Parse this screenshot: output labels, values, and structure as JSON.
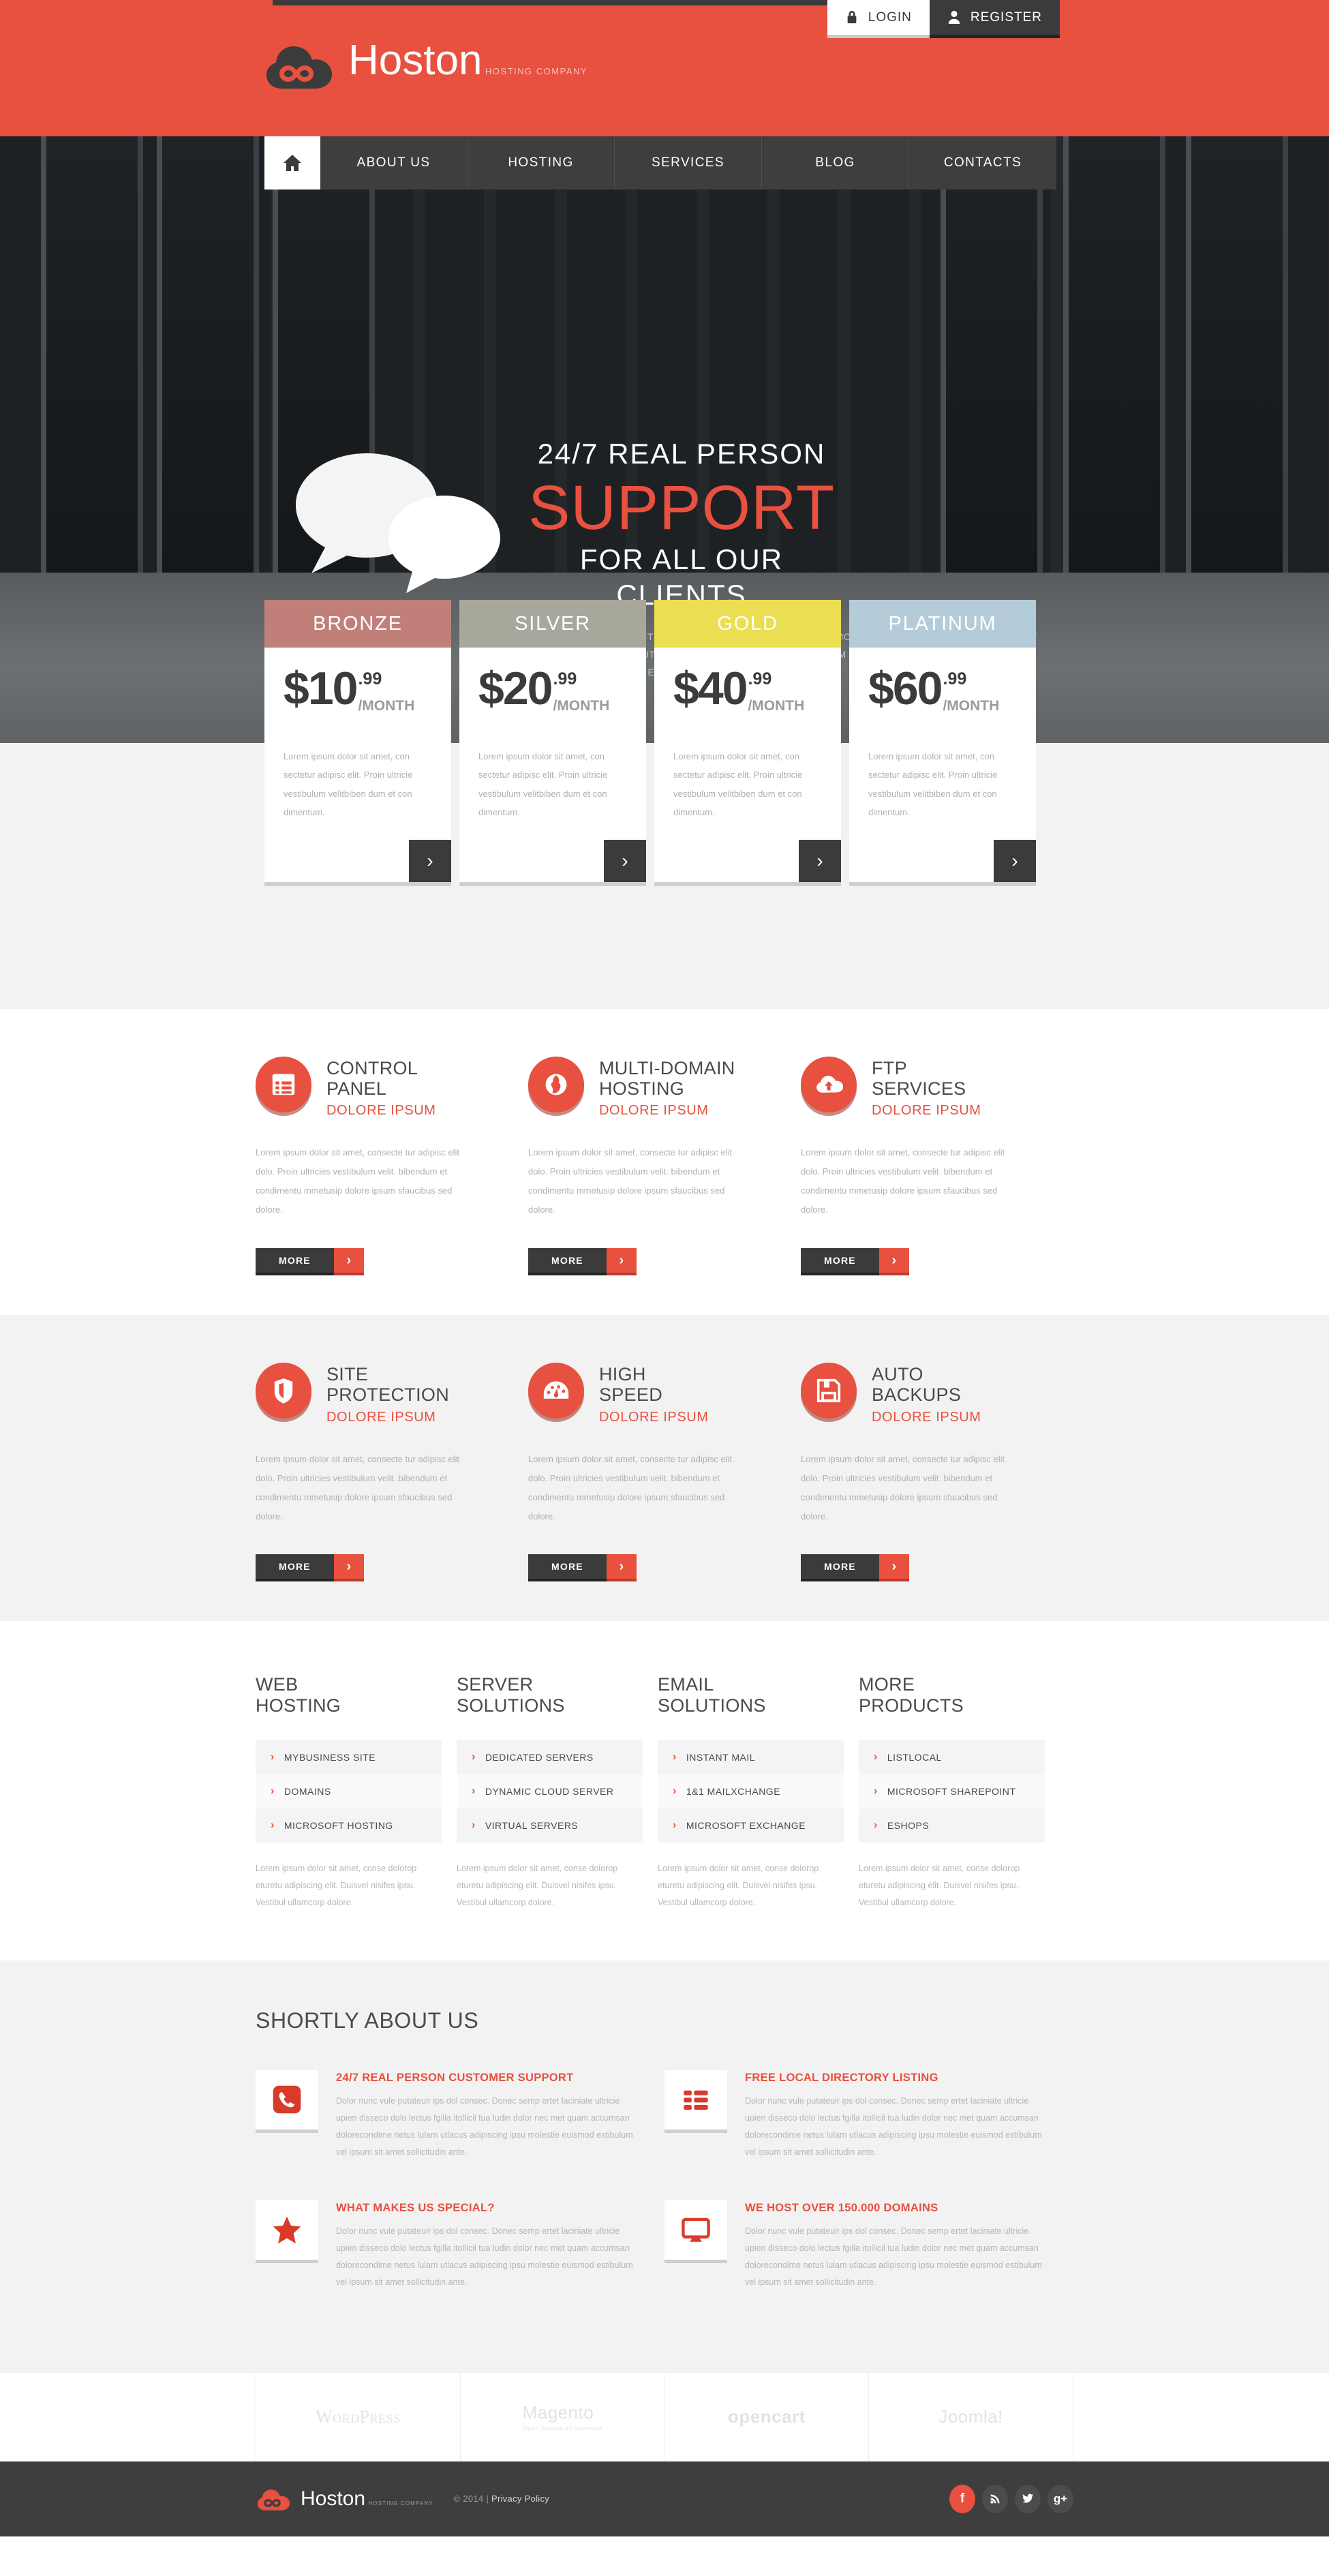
{
  "brand": {
    "name": "Hoston",
    "tagline": "HOSTING COMPANY",
    "logo_icon": "cloud-infinity-logo"
  },
  "auth": {
    "login_label": "LOGIN",
    "login_icon": "lock-icon",
    "register_label": "REGISTER",
    "register_icon": "user-icon"
  },
  "nav": {
    "home_icon": "home-icon",
    "items": [
      {
        "label": "ABOUT US"
      },
      {
        "label": "HOSTING"
      },
      {
        "label": "SERVICES"
      },
      {
        "label": "BLOG"
      },
      {
        "label": "CONTACTS"
      }
    ]
  },
  "hero": {
    "icon": "speech-bubbles-icon",
    "line1": "24/7 REAL PERSON",
    "line2": "SUPPORT",
    "line3": "FOR ALL OUR CLIENTS",
    "description": "DOLOR SIT AMET, CONSECTETUR ADIPISICING ELIT, SED DO EIUSMOD TEMPOR INCIDIDUNT UT LABORE ET DOLORE MAGNA ALIQUA. UT ENIM AD MINIM VENIAM. LOREM IPSUM DOLOR SIT AMET, CONSECTE TUR ADIPISICING ELIT, SED DO EIUSMOD TEMPOR."
  },
  "pricing": {
    "plans": [
      {
        "name": "BRONZE",
        "currency": "$",
        "amount": "10",
        "cents": ".99",
        "period": "/MONTH",
        "description": "Lorem ipsum dolor sit amet, con sectetur adipisc elit. Proin ultricie vestibulum velitbiben dum et con dimentum.",
        "color": "#c08079",
        "go_icon": "chevron-right-icon"
      },
      {
        "name": "SILVER",
        "currency": "$",
        "amount": "20",
        "cents": ".99",
        "period": "/MONTH",
        "description": "Lorem ipsum dolor sit amet, con sectetur adipisc elit. Proin ultricie vestibulum velitbiben dum et con dimentum.",
        "color": "#a8a79b",
        "go_icon": "chevron-right-icon"
      },
      {
        "name": "GOLD",
        "currency": "$",
        "amount": "40",
        "cents": ".99",
        "period": "/MONTH",
        "description": "Lorem ipsum dolor sit amet, con sectetur adipisc elit. Proin ultricie vestibulum velitbiben dum et con dimentum.",
        "color": "#ecde52",
        "go_icon": "chevron-right-icon"
      },
      {
        "name": "PLATINUM",
        "currency": "$",
        "amount": "60",
        "cents": ".99",
        "period": "/MONTH",
        "description": "Lorem ipsum dolor sit amet, con sectetur adipisc elit. Proin ultricie vestibulum velitbiben dum et con dimentum.",
        "color": "#b4ccd9",
        "go_icon": "chevron-right-icon"
      }
    ]
  },
  "services_row1": [
    {
      "title_line1": "CONTROL",
      "title_line2": "PANEL",
      "subtitle": "DOLORE IPSUM",
      "text": "Lorem ipsum dolor sit amet, consecte tur adipisc elit dolo. Proin ultricies vestibulum velit. bibendum et condimentu mmetusip dolore ipsum sfaucibus sed dolore.",
      "icon": "control-panel-list-icon",
      "button_label": "MORE"
    },
    {
      "title_line1": "MULTI-DOMAIN",
      "title_line2": "HOSTING",
      "subtitle": "DOLORE IPSUM",
      "text": "Lorem ipsum dolor sit amet, consecte tur adipisc elit dolo. Proin ultricies vestibulum velit. bibendum et condimentu mmetusip dolore ipsum sfaucibus sed dolore.",
      "icon": "globe-icon",
      "button_label": "MORE"
    },
    {
      "title_line1": "FTP",
      "title_line2": "SERVICES",
      "subtitle": "DOLORE IPSUM",
      "text": "Lorem ipsum dolor sit amet, consecte tur adipisc elit dolo. Proin ultricies vestibulum velit. bibendum et condimentu mmetusip dolore ipsum sfaucibus sed dolore.",
      "icon": "cloud-upload-icon",
      "button_label": "MORE"
    }
  ],
  "services_row2": [
    {
      "title_line1": "SITE",
      "title_line2": "PROTECTION",
      "subtitle": "DOLORE IPSUM",
      "text": "Lorem ipsum dolor sit amet, consecte tur adipisc elit dolo. Proin ultricies vestibulum velit. bibendum et condimentu mmetusip dolore ipsum sfaucibus sed dolore.",
      "icon": "shield-icon",
      "button_label": "MORE"
    },
    {
      "title_line1": "HIGH",
      "title_line2": "SPEED",
      "subtitle": "DOLORE IPSUM",
      "text": "Lorem ipsum dolor sit amet, consecte tur adipisc elit dolo. Proin ultricies vestibulum velit. bibendum et condimentu mmetusip dolore ipsum sfaucibus sed dolore.",
      "icon": "speedometer-icon",
      "button_label": "MORE"
    },
    {
      "title_line1": "AUTO",
      "title_line2": "BACKUPS",
      "subtitle": "DOLORE IPSUM",
      "text": "Lorem ipsum dolor sit amet, consecte tur adipisc elit dolo. Proin ultricies vestibulum velit. bibendum et condimentu mmetusip dolore ipsum sfaucibus sed dolore.",
      "icon": "floppy-disk-icon",
      "button_label": "MORE"
    }
  ],
  "link_columns": [
    {
      "title_line1": "WEB",
      "title_line2": "HOSTING",
      "items": [
        "MYBUSINESS SITE",
        "DOMAINS",
        "MICROSOFT HOSTING"
      ],
      "text": "Lorem ipsum dolor sit amet, conse dolorop eturetu adipiscing elit. Duisvel nisifes ipsu. Vestibul ullamcorp dolore."
    },
    {
      "title_line1": "SERVER",
      "title_line2": "SOLUTIONS",
      "items": [
        "DEDICATED SERVERS",
        "DYNAMIC CLOUD SERVER",
        "VIRTUAL SERVERS"
      ],
      "text": "Lorem ipsum dolor sit amet, conse dolorop eturetu adipiscing elit. Duisvel nisifes ipsu. Vestibul ullamcorp dolore."
    },
    {
      "title_line1": "EMAIL",
      "title_line2": "SOLUTIONS",
      "items": [
        "INSTANT MAIL",
        "1&1 MAILXCHANGE",
        "MICROSOFT EXCHANGE"
      ],
      "text": "Lorem ipsum dolor sit amet, conse dolorop eturetu adipiscing elit. Duisvel nisifes ipsu. Vestibul ullamcorp dolore."
    },
    {
      "title_line1": "MORE",
      "title_line2": "PRODUCTS",
      "items": [
        "LISTLOCAL",
        "MICROSOFT SHAREPOINT",
        "ESHOPS"
      ],
      "text": "Lorem ipsum dolor sit amet, conse dolorop eturetu adipiscing elit. Duisvel nisifes ipsu. Vestibul ullamcorp dolore."
    }
  ],
  "about": {
    "title": "SHORTLY ABOUT US",
    "items": [
      {
        "heading": "24/7 REAL PERSON CUSTOMER SUPPORT",
        "text": "Dolor nunc vule putateuir ips dol consec. Donec semp ertet laciniate ultricie upien disseco dolo lectus fgilla itollicil tua ludin dolor nec met quam accumsan dolorecondime netus lulam utlacus adipiscing ipsu molestie euismod estibulum vel ipsum sit amet sollicitudin ante.",
        "icon": "phone-icon"
      },
      {
        "heading": "FREE LOCAL DIRECTORY LISTING",
        "text": "Dolor nunc vule putateuir ips dol consec. Donec semp ertet laciniate ultricie upien disseco dolo lectus fgilla itollicil tua ludin dolor nec met quam accumsan dolorecondime netus lulam utlacus adipiscing ipsu molestie euismod estibulum vel ipsum sit amet sollicitudin ante.",
        "icon": "list-grid-icon"
      },
      {
        "heading": "WHAT MAKES US SPECIAL?",
        "text": "Dolor nunc vule putateuir ips dol consec. Donec semp ertet laciniate ultricie upien disseco dolo lectus fgilla itollicil tua ludin dolor nec met quam accumsan dolorecondime netus lulam utlacus adipiscing ipsu molestie euismod estibulum vel ipsum sit amet sollicitudin ante.",
        "icon": "star-icon"
      },
      {
        "heading": "WE HOST OVER 150.000 DOMAINS",
        "text": "Dolor nunc vule putateuir ips dol consec. Donec semp ertet laciniate ultricie upien disseco dolo lectus fgilla itollicil tua ludin dolor nec met quam accumsan dolorecondime netus lulam utlacus adipiscing ipsu molestie euismod estibulum vel ipsum sit amet sollicitudin ante.",
        "icon": "monitor-icon"
      }
    ]
  },
  "partners": [
    {
      "name": "WordPress",
      "sub": "",
      "icon": "wordpress-logo"
    },
    {
      "name": "Magento",
      "sub": "Open Source eCommerce",
      "icon": "magento-logo"
    },
    {
      "name": "opencart",
      "sub": "",
      "icon": "opencart-logo"
    },
    {
      "name": "Joomla!",
      "sub": "",
      "icon": "joomla-logo"
    }
  ],
  "footer": {
    "brand_name": "Hoston",
    "brand_tag": "HOSTING COMPANY",
    "copyright": "© 2014  |  ",
    "privacy_label": "Privacy Policy",
    "socials": [
      {
        "name": "facebook-icon",
        "glyph": "f"
      },
      {
        "name": "rss-icon",
        "glyph": "◠"
      },
      {
        "name": "twitter-icon",
        "glyph": "ᵗ"
      },
      {
        "name": "google-plus-icon",
        "glyph": "g+"
      }
    ]
  },
  "colors": {
    "accent": "#e8503f",
    "dark": "#3b3b3b",
    "light_grey": "#f2f2f2"
  }
}
